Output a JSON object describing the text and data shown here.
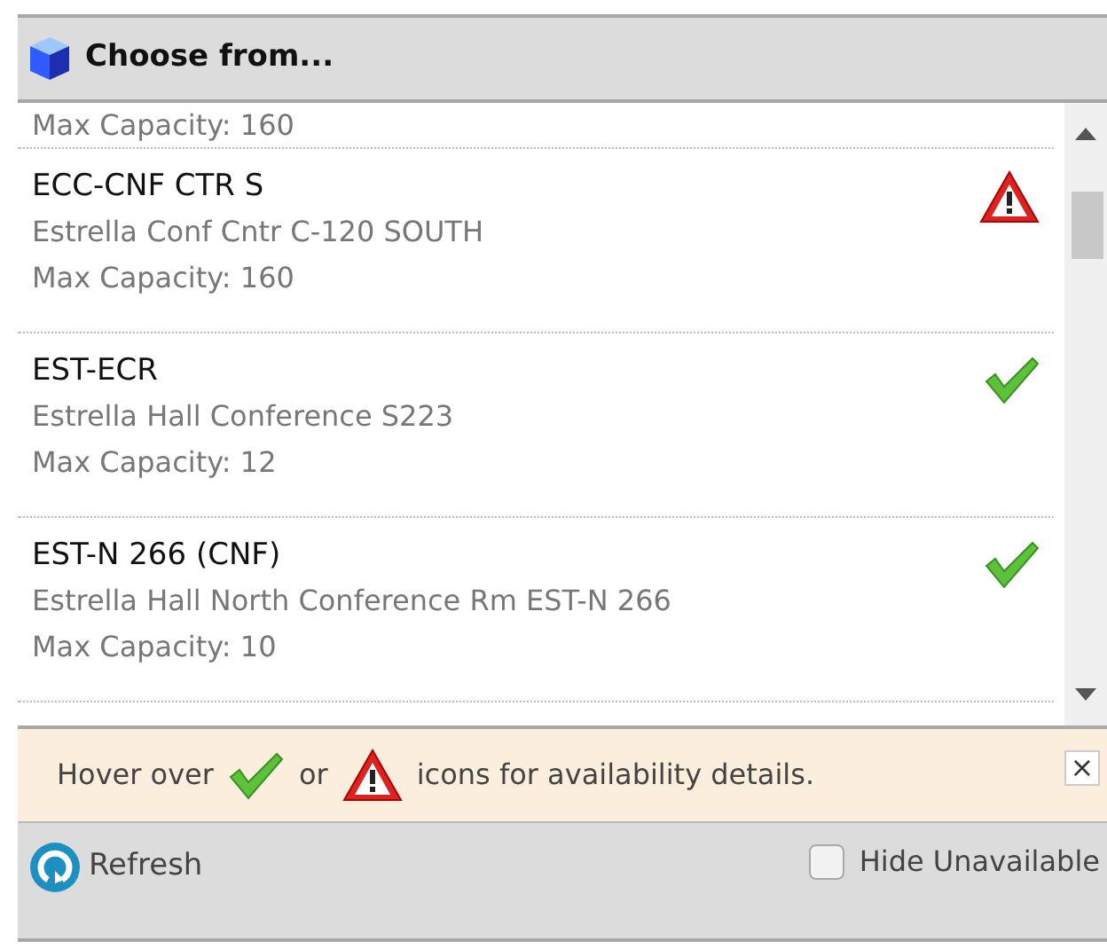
{
  "dialog": {
    "title": "Choose from..."
  },
  "partial_row": {
    "capacity": "Max Capacity: 160"
  },
  "rooms": [
    {
      "name": "ECC-CNF CTR S",
      "description": "Estrella Conf Cntr C-120 SOUTH",
      "capacity": "Max Capacity: 160",
      "kind": "unavailable"
    },
    {
      "name": "EST-ECR",
      "description": "Estrella Hall Conference S223",
      "capacity": "Max Capacity: 12",
      "kind": "available"
    },
    {
      "name": "EST-N 266 (CNF)",
      "description": "Estrella Hall North Conference Rm EST-N 266",
      "capacity": "Max Capacity: 10",
      "kind": "available"
    }
  ],
  "hint": {
    "before": "Hover over",
    "middle": "or",
    "after": "icons for availability details.",
    "close": "×"
  },
  "footer": {
    "refresh": "Refresh",
    "hide_unavailable": {
      "label": "Hide Unavailable",
      "checked": false
    }
  }
}
